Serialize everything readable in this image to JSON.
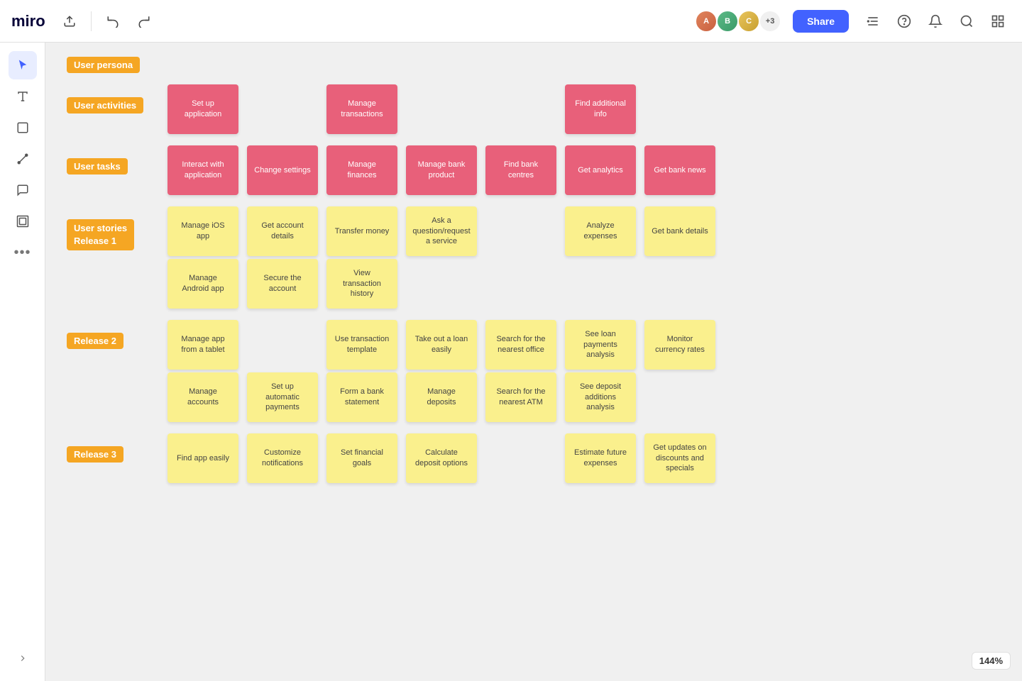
{
  "topbar": {
    "logo": "miro",
    "upload_label": "↑",
    "undo_label": "↩",
    "redo_label": "↪",
    "share_label": "Share",
    "avatars": [
      {
        "initials": "A",
        "color": "#e0845c"
      },
      {
        "initials": "B",
        "color": "#6eb36e"
      },
      {
        "initials": "C",
        "color": "#e0c45c"
      },
      {
        "count": "+3"
      }
    ]
  },
  "sidebar": {
    "items": [
      {
        "name": "cursor",
        "symbol": "↖",
        "active": true
      },
      {
        "name": "text",
        "symbol": "T"
      },
      {
        "name": "note",
        "symbol": "⬜"
      },
      {
        "name": "line",
        "symbol": "/"
      },
      {
        "name": "comment",
        "symbol": "💬"
      },
      {
        "name": "frame",
        "symbol": "⬛"
      },
      {
        "name": "more",
        "symbol": "•••"
      }
    ]
  },
  "canvas": {
    "sections": {
      "user_persona": "User persona",
      "user_activities": "User activities",
      "user_tasks": "User tasks",
      "user_stories_r1": "User stories\nRelease 1",
      "release2": "Release 2",
      "release3": "Release 3"
    },
    "activities_pink": [
      {
        "col": 1,
        "text": "Set up application"
      },
      {
        "col": 3,
        "text": "Manage transactions"
      },
      {
        "col": 6,
        "text": "Find additional info"
      }
    ],
    "tasks_pink": [
      {
        "col": 1,
        "text": "Interact with application"
      },
      {
        "col": 2,
        "text": "Change settings"
      },
      {
        "col": 3,
        "text": "Manage finances"
      },
      {
        "col": 4,
        "text": "Manage bank product"
      },
      {
        "col": 5,
        "text": "Find bank centres"
      },
      {
        "col": 6,
        "text": "Get analytics"
      },
      {
        "col": 7,
        "text": "Get bank news"
      }
    ],
    "stories_r1_row1": [
      {
        "col": 1,
        "text": "Manage iOS app"
      },
      {
        "col": 2,
        "text": "Get account details"
      },
      {
        "col": 3,
        "text": "Transfer money"
      },
      {
        "col": 4,
        "text": "Ask a question/request a service"
      },
      {
        "col": 6,
        "text": "Analyze expenses"
      },
      {
        "col": 7,
        "text": "Get bank details"
      }
    ],
    "stories_r1_row2": [
      {
        "col": 1,
        "text": "Manage Android app"
      },
      {
        "col": 2,
        "text": "Secure the account"
      },
      {
        "col": 3,
        "text": "View transaction history"
      }
    ],
    "release2_row1": [
      {
        "col": 1,
        "text": "Manage app from a tablet"
      },
      {
        "col": 3,
        "text": "Use transaction template"
      },
      {
        "col": 4,
        "text": "Take out a loan easily"
      },
      {
        "col": 5,
        "text": "Search for the nearest office"
      },
      {
        "col": 6,
        "text": "See loan payments analysis"
      },
      {
        "col": 7,
        "text": "Monitor currency rates"
      }
    ],
    "release2_row2": [
      {
        "col": 1,
        "text": "Manage accounts"
      },
      {
        "col": 2,
        "text": "Set up automatic payments"
      },
      {
        "col": 3,
        "text": "Form a bank statement"
      },
      {
        "col": 4,
        "text": "Manage deposits"
      },
      {
        "col": 5,
        "text": "Search for the nearest ATM"
      },
      {
        "col": 6,
        "text": "See deposit additions analysis"
      }
    ],
    "release3_row1": [
      {
        "col": 1,
        "text": "Find app easily"
      },
      {
        "col": 2,
        "text": "Customize notifications"
      },
      {
        "col": 3,
        "text": "Set financial goals"
      },
      {
        "col": 4,
        "text": "Calculate deposit options"
      },
      {
        "col": 6,
        "text": "Estimate future expenses"
      },
      {
        "col": 7,
        "text": "Get updates on discounts and specials"
      }
    ]
  },
  "zoom": "144%"
}
